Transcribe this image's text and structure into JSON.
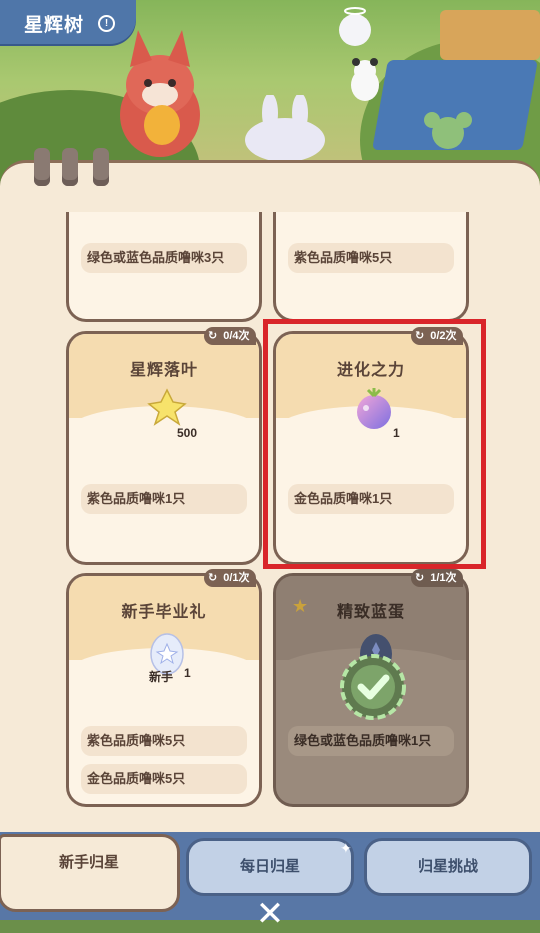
{
  "header": {
    "title": "星辉树",
    "info_icon": "!"
  },
  "cards": [
    {
      "name": "",
      "requirements": [
        "绿色或蓝色品质噜咪3只"
      ]
    },
    {
      "name": "",
      "requirements": [
        "紫色品质噜咪5只"
      ]
    },
    {
      "name": "星辉落叶",
      "counter": "0/4次",
      "reward_icon": "golden-leaf-icon",
      "reward_qty": "500",
      "requirements": [
        "紫色品质噜咪1只"
      ]
    },
    {
      "name": "进化之力",
      "counter": "0/2次",
      "reward_icon": "evolution-fruit-icon",
      "reward_qty": "1",
      "requirements": [
        "金色品质噜咪1只"
      ]
    },
    {
      "name": "新手毕业礼",
      "counter": "0/1次",
      "reward_icon": "star-egg-icon",
      "reward_qty": "1",
      "reward_tag": "新手",
      "requirements": [
        "紫色品质噜咪5只",
        "金色品质噜咪5只"
      ]
    },
    {
      "name": "精致蓝蛋",
      "counter": "1/1次",
      "reward_icon": "blue-egg-icon",
      "status": "completed",
      "requirements": [
        "绿色或蓝色品质噜咪1只"
      ]
    }
  ],
  "tabs": [
    {
      "label": "新手归星",
      "active": true
    },
    {
      "label": "每日归星",
      "active": false
    },
    {
      "label": "归星挑战",
      "active": false
    }
  ],
  "colors": {
    "panel": "#f6ead7",
    "highlight": "#d9252a",
    "tabbar": "#5877a6"
  }
}
